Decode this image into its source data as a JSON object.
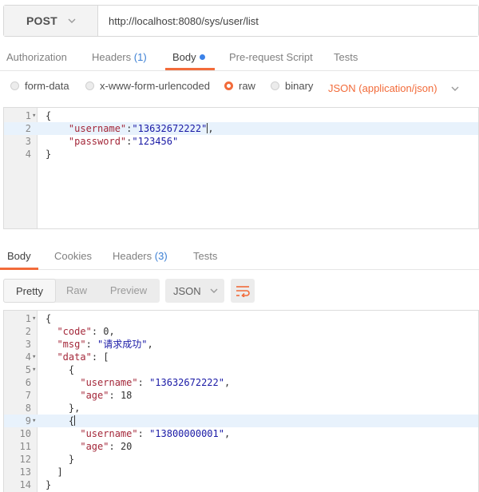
{
  "request": {
    "method": "POST",
    "url": "http://localhost:8080/sys/user/list",
    "tabs": {
      "authorization": "Authorization",
      "headers_label": "Headers",
      "headers_count": "(1)",
      "body": "Body",
      "prerequest": "Pre-request Script",
      "tests": "Tests"
    },
    "body_types": {
      "form_data": "form-data",
      "urlencoded": "x-www-form-urlencoded",
      "raw": "raw",
      "binary": "binary",
      "content_type": "JSON (application/json)"
    },
    "editor_lines": [
      "1",
      "2",
      "3",
      "4"
    ],
    "body_json": {
      "open": "{",
      "username_key": "\"username\"",
      "username_value": "\"13632672222\"",
      "password_key": "\"password\"",
      "password_value": "\"123456\"",
      "close": "}"
    }
  },
  "response": {
    "tabs": {
      "body": "Body",
      "cookies": "Cookies",
      "headers_label": "Headers",
      "headers_count": "(3)",
      "tests": "Tests"
    },
    "view_modes": {
      "pretty": "Pretty",
      "raw": "Raw",
      "preview": "Preview"
    },
    "format": "JSON",
    "lines": [
      "1",
      "2",
      "3",
      "4",
      "5",
      "6",
      "7",
      "8",
      "9",
      "10",
      "11",
      "12",
      "13",
      "14"
    ],
    "json": {
      "code_key": "\"code\"",
      "code_value": "0",
      "msg_key": "\"msg\"",
      "msg_value": "\"请求成功\"",
      "data_key": "\"data\"",
      "user1_username": "\"13632672222\"",
      "user1_age": "18",
      "user2_username": "\"13800000001\"",
      "user2_age": "20",
      "username_key": "\"username\"",
      "age_key": "\"age\""
    }
  },
  "colors": {
    "accent": "#f26b3a",
    "count_blue": "#3b7fd4",
    "json_key": "#a4283a",
    "json_string": "#1a1aa6",
    "line_highlight": "#e8f2fc"
  }
}
